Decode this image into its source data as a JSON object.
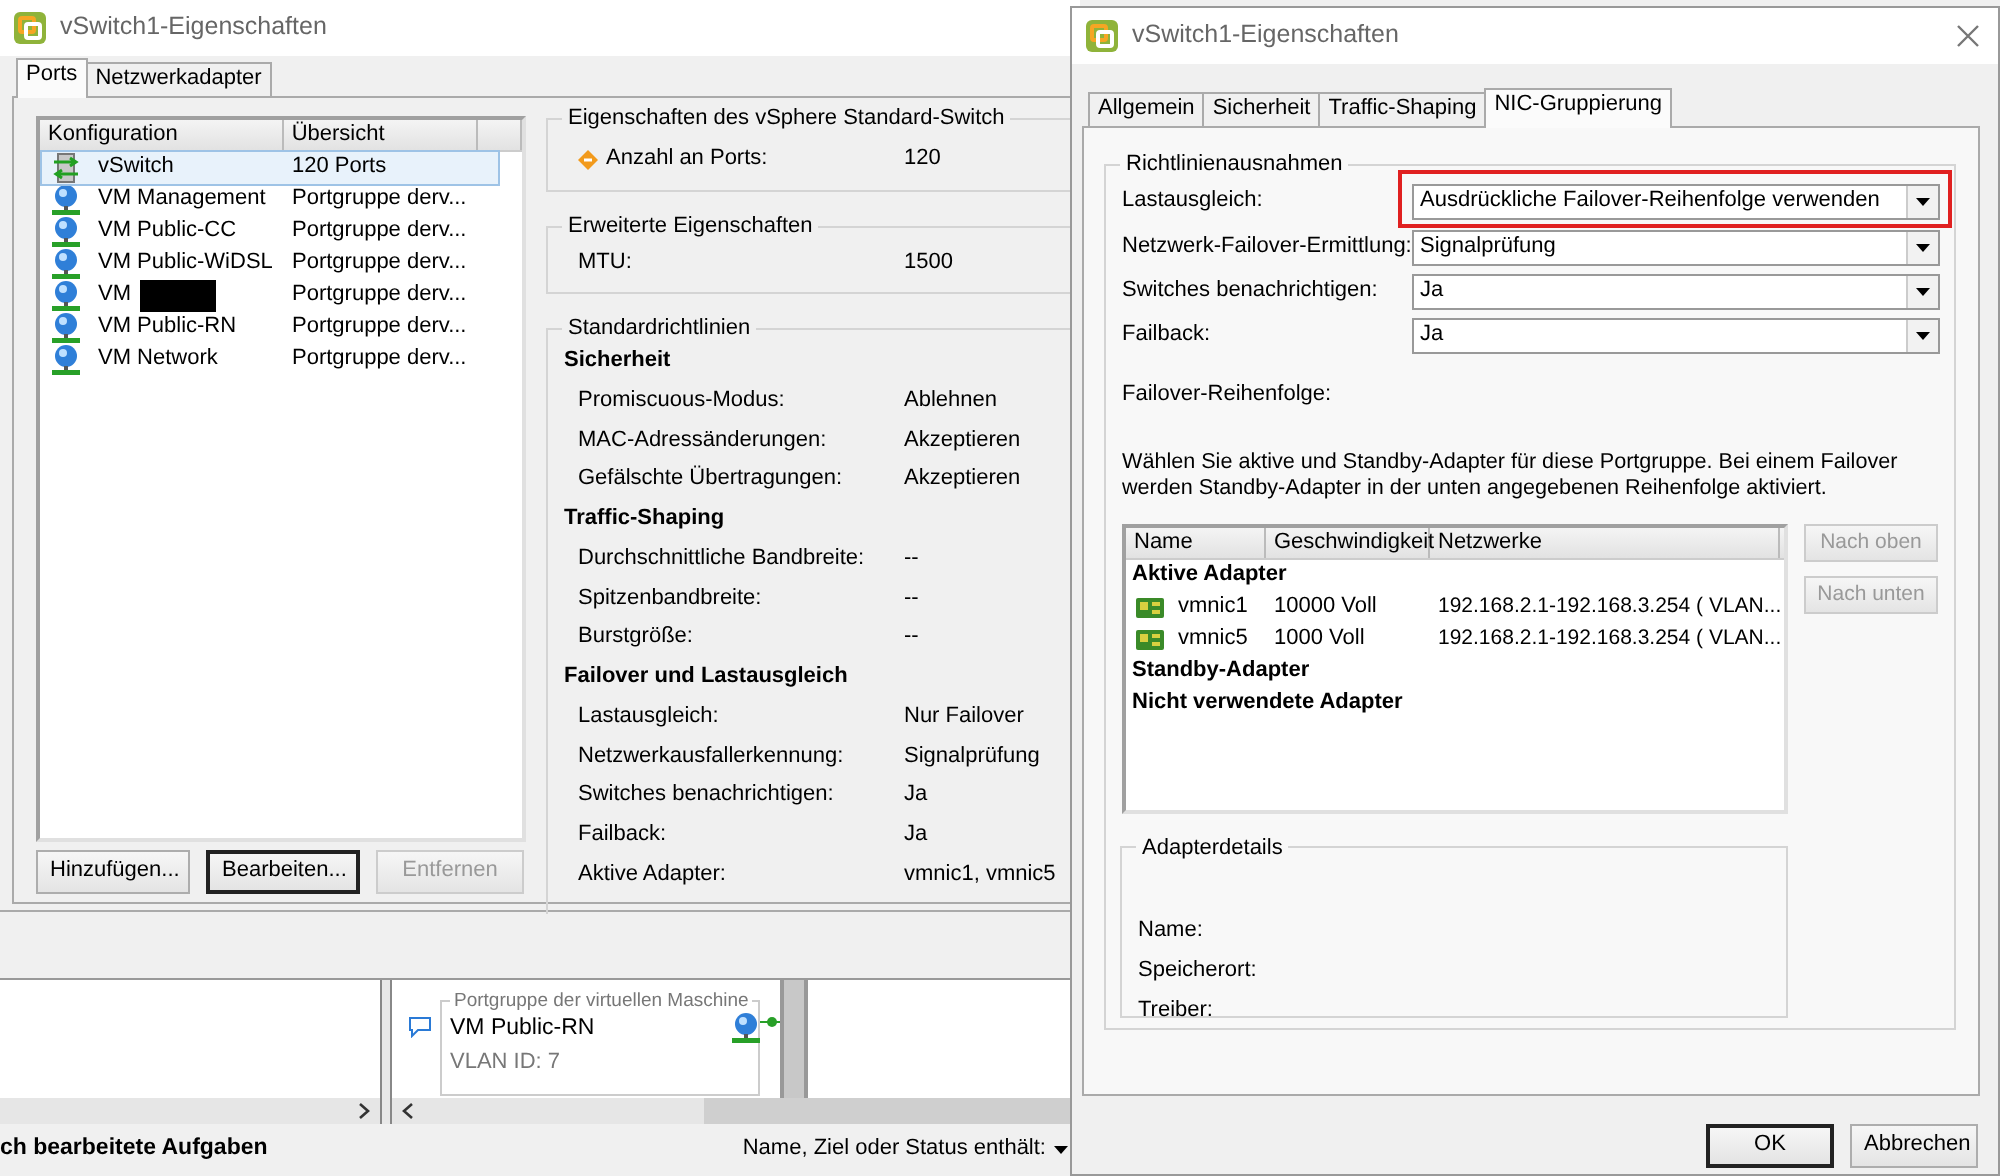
{
  "main_window": {
    "title": "vSwitch1-Eigenschaften",
    "tabs": [
      {
        "label": "Ports",
        "selected": true
      },
      {
        "label": "Netzwerkadapter",
        "selected": false
      }
    ],
    "list": {
      "columns": [
        "Konfiguration",
        "Übersicht"
      ],
      "rows": [
        {
          "kind": "switch",
          "name": "vSwitch",
          "summary": "120 Ports",
          "selected": true,
          "redacted": false
        },
        {
          "kind": "portgroup",
          "name": "VM Management",
          "summary": "Portgruppe derv...",
          "selected": false,
          "redacted": false
        },
        {
          "kind": "portgroup",
          "name": "VM Public-CC",
          "summary": "Portgruppe derv...",
          "selected": false,
          "redacted": false
        },
        {
          "kind": "portgroup",
          "name": "VM Public-WiDSL",
          "summary": "Portgruppe derv...",
          "selected": false,
          "redacted": false
        },
        {
          "kind": "portgroup",
          "name": "VM",
          "summary": "Portgruppe derv...",
          "selected": false,
          "redacted": true
        },
        {
          "kind": "portgroup",
          "name": "VM Public-RN",
          "summary": "Portgruppe derv...",
          "selected": false,
          "redacted": false
        },
        {
          "kind": "portgroup",
          "name": "VM Network",
          "summary": "Portgruppe derv...",
          "selected": false,
          "redacted": false
        }
      ]
    },
    "buttons": [
      {
        "label": "Hinzufügen...",
        "focused": false,
        "disabled": false
      },
      {
        "label": "Bearbeiten...",
        "focused": true,
        "disabled": false
      },
      {
        "label": "Entfernen",
        "focused": false,
        "disabled": true
      }
    ],
    "groups": [
      {
        "title": "Eigenschaften des vSphere Standard-Switch",
        "rows": [
          {
            "label": "Anzahl an Ports:",
            "value": "120",
            "icon": true
          }
        ]
      },
      {
        "title": "Erweiterte Eigenschaften",
        "rows": [
          {
            "label": "MTU:",
            "value": "1500",
            "icon": false
          }
        ]
      },
      {
        "title": "Standardrichtlinien",
        "sections": [
          {
            "heading": "Sicherheit",
            "rows": [
              {
                "label": "Promiscuous-Modus:",
                "value": "Ablehnen"
              },
              {
                "label": "MAC-Adressänderungen:",
                "value": "Akzeptieren"
              },
              {
                "label": "Gefälschte Übertragungen:",
                "value": "Akzeptieren"
              }
            ]
          },
          {
            "heading": "Traffic-Shaping",
            "rows": [
              {
                "label": "Durchschnittliche Bandbreite:",
                "value": "--"
              },
              {
                "label": "Spitzenbandbreite:",
                "value": "--"
              },
              {
                "label": "Burstgröße:",
                "value": "--"
              }
            ]
          },
          {
            "heading": "Failover und Lastausgleich",
            "rows": [
              {
                "label": "Lastausgleich:",
                "value": "Nur Failover"
              },
              {
                "label": "Netzwerkausfallerkennung:",
                "value": "Signalprüfung"
              },
              {
                "label": "Switches benachrichtigen:",
                "value": "Ja"
              },
              {
                "label": "Failback:",
                "value": "Ja"
              },
              {
                "label": "Aktive Adapter:",
                "value": "vmnic1, vmnic5"
              }
            ]
          }
        ]
      }
    ]
  },
  "diagram": {
    "caption": "Portgruppe der virtuellen Maschine",
    "name": "VM Public-RN",
    "vlan": "VLAN ID: 7"
  },
  "status_bar": {
    "tasks": "ch bearbeitete Aufgaben",
    "filter_label": "Name, Ziel oder Status enthält:"
  },
  "dialog": {
    "title": "vSwitch1-Eigenschaften",
    "tabs": [
      {
        "label": "Allgemein",
        "selected": false
      },
      {
        "label": "Sicherheit",
        "selected": false
      },
      {
        "label": "Traffic-Shaping",
        "selected": false
      },
      {
        "label": "NIC-Gruppierung",
        "selected": true
      }
    ],
    "legend": "Richtlinienausnahmen",
    "fields": [
      {
        "label": "Lastausgleich:",
        "value": "Ausdrückliche Failover-Reihenfolge verwenden",
        "highlighted": true
      },
      {
        "label": "Netzwerk-Failover-Ermittlung:",
        "value": "Signalprüfung",
        "highlighted": false
      },
      {
        "label": "Switches benachrichtigen:",
        "value": "Ja",
        "highlighted": false
      },
      {
        "label": "Failback:",
        "value": "Ja",
        "highlighted": false
      }
    ],
    "order_label": "Failover-Reihenfolge:",
    "hint": "Wählen Sie aktive und Standby-Adapter für diese Portgruppe. Bei einem Failover werden Standby-Adapter in der unten angegebenen Reihenfolge aktiviert.",
    "table": {
      "columns": [
        "Name",
        "Geschwindigkeit",
        "Netzwerke"
      ],
      "groups": [
        {
          "title": "Aktive Adapter",
          "adapters": [
            {
              "name": "vmnic1",
              "speed": "10000 Voll",
              "networks": "192.168.2.1-192.168.3.254 ( VLAN..."
            },
            {
              "name": "vmnic5",
              "speed": "1000 Voll",
              "networks": "192.168.2.1-192.168.3.254 ( VLAN..."
            }
          ]
        },
        {
          "title": "Standby-Adapter"
        },
        {
          "title": "Nicht verwendete Adapter"
        }
      ]
    },
    "side_buttons": [
      {
        "label": "Nach oben",
        "disabled": true
      },
      {
        "label": "Nach unten",
        "disabled": true
      }
    ],
    "details_legend": "Adapterdetails",
    "details": [
      "Name:",
      "Speicherort:",
      "Treiber:"
    ],
    "footer_buttons": [
      {
        "label": "OK",
        "default": true
      },
      {
        "label": "Abbrechen",
        "default": false
      }
    ]
  }
}
